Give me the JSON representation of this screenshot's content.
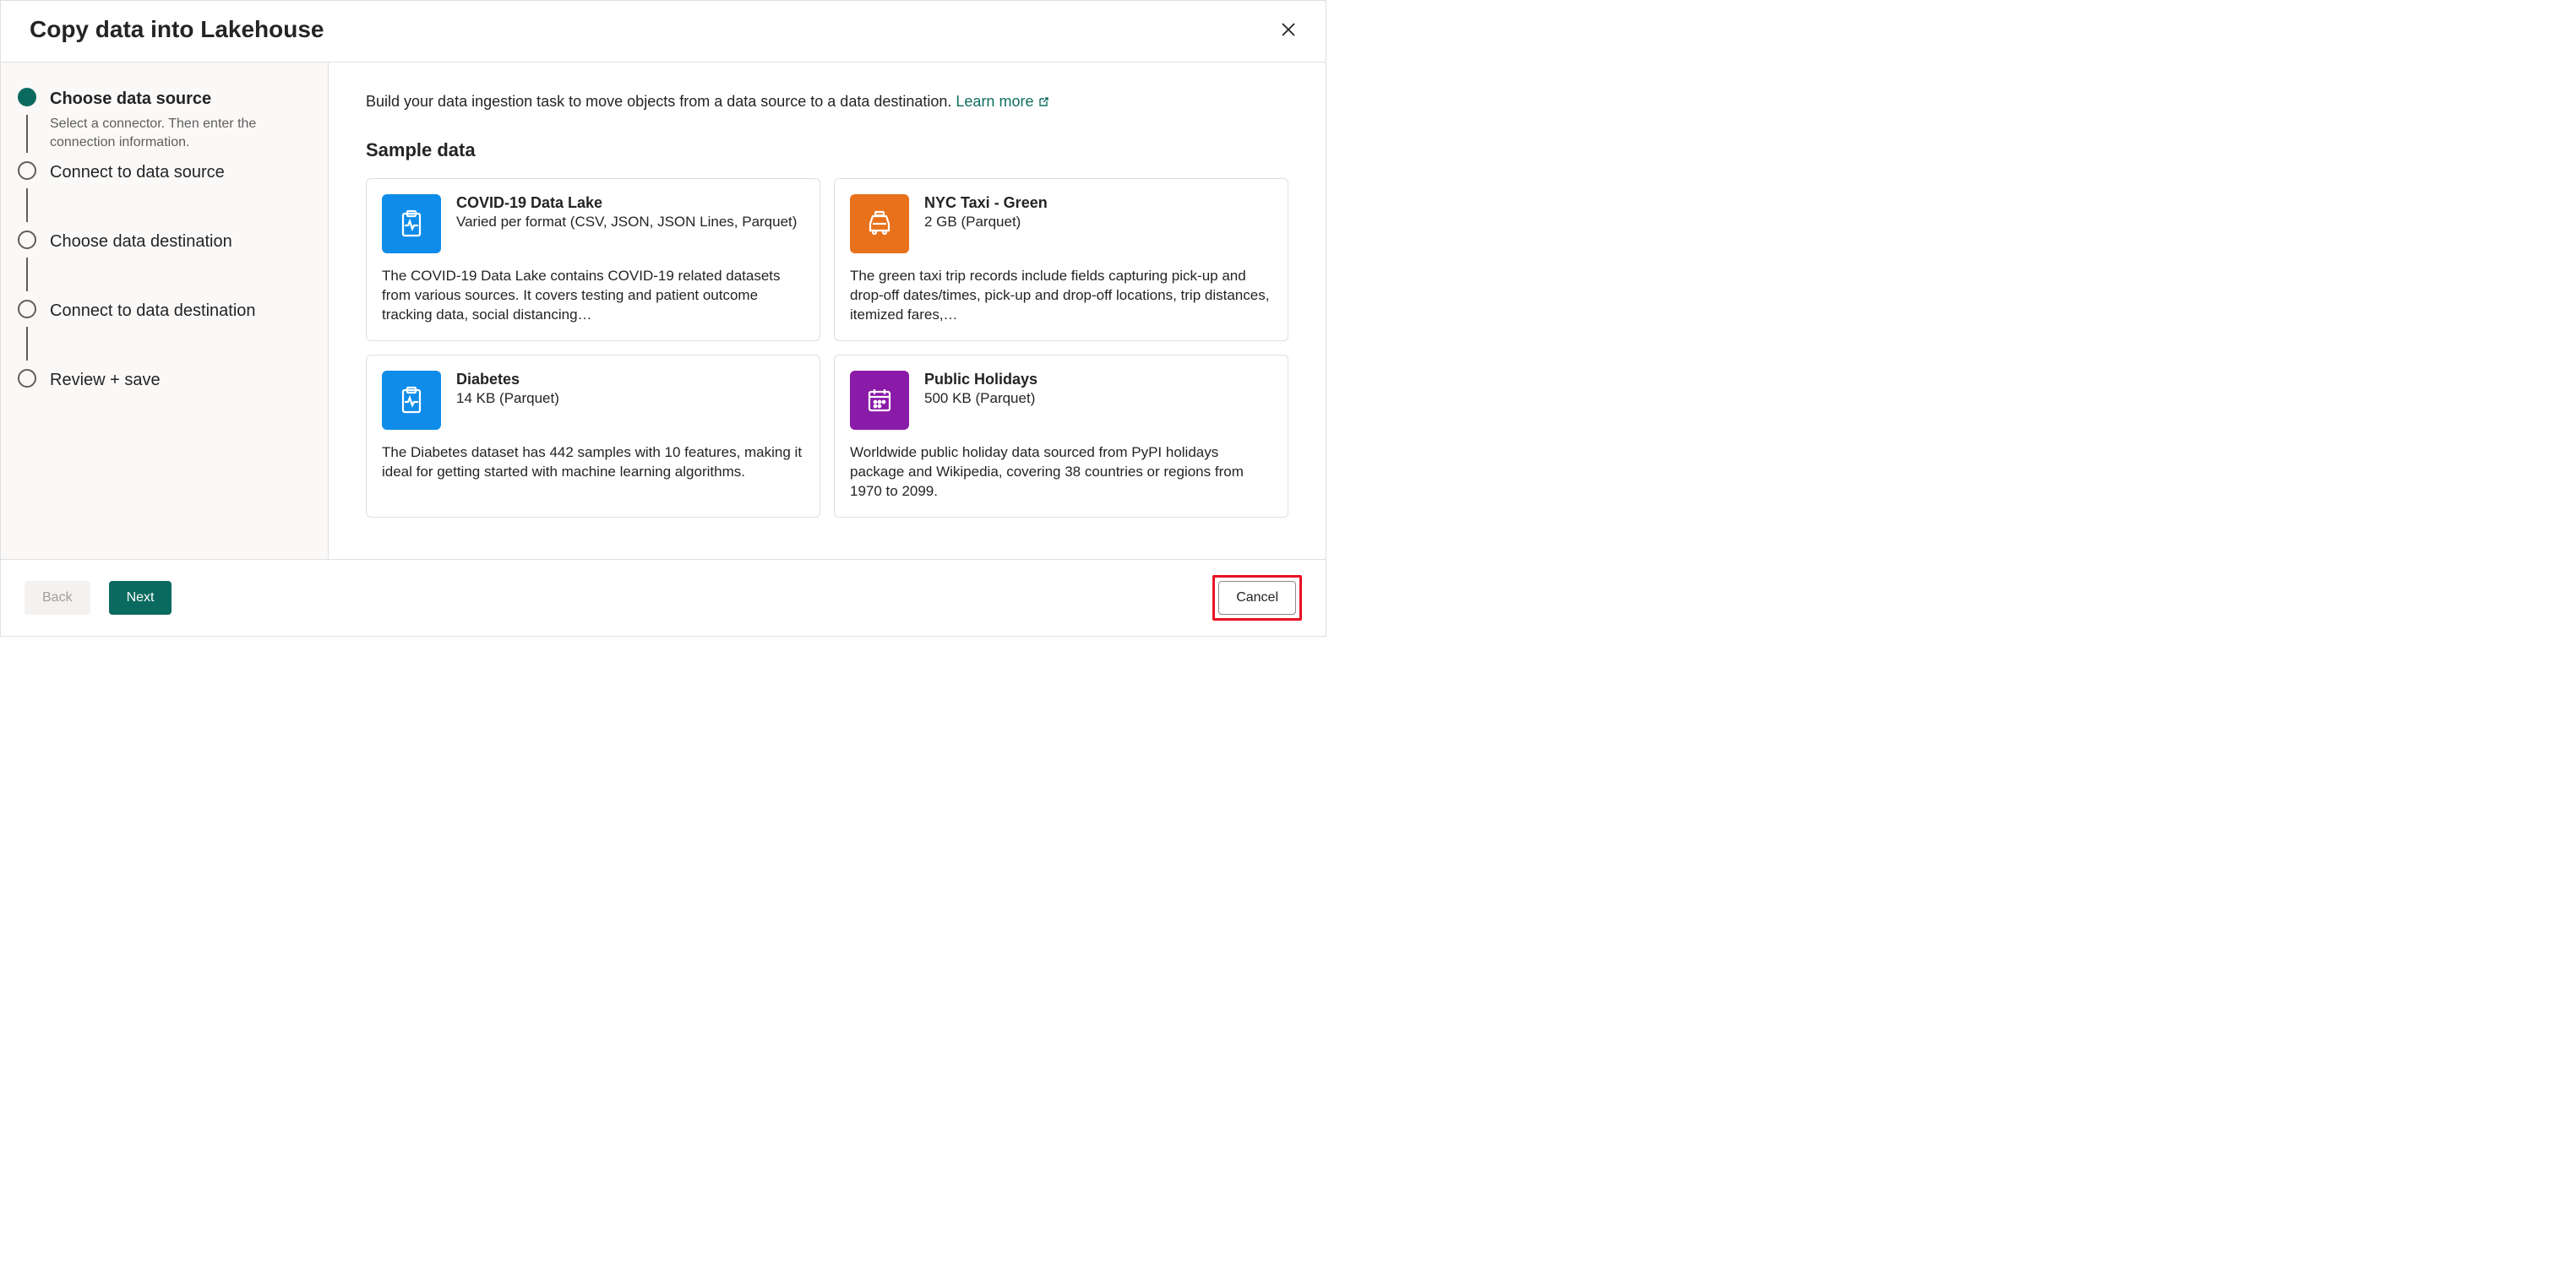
{
  "header": {
    "title": "Copy data into Lakehouse"
  },
  "sidebar": {
    "steps": [
      {
        "title": "Choose data source",
        "desc": "Select a connector. Then enter the connection information.",
        "active": true
      },
      {
        "title": "Connect to data source",
        "desc": "",
        "active": false
      },
      {
        "title": "Choose data destination",
        "desc": "",
        "active": false
      },
      {
        "title": "Connect to data destination",
        "desc": "",
        "active": false
      },
      {
        "title": "Review + save",
        "desc": "",
        "active": false
      }
    ]
  },
  "main": {
    "intro_text": "Build your data ingestion task to move objects from a data source to a data destination. ",
    "learn_more_label": "Learn more",
    "section_title": "Sample data",
    "cards": [
      {
        "title": "COVID-19 Data Lake",
        "sub": "Varied per format (CSV, JSON, JSON Lines, Parquet)",
        "desc": "The COVID-19 Data Lake contains COVID-19 related datasets from various sources. It covers testing and patient outcome tracking data, social distancing…",
        "icon": "clipboard-pulse-icon",
        "color": "#0f8ce9"
      },
      {
        "title": "NYC Taxi - Green",
        "sub": "2 GB (Parquet)",
        "desc": "The green taxi trip records include fields capturing pick-up and drop-off dates/times, pick-up and drop-off locations, trip distances, itemized fares,…",
        "icon": "taxi-icon",
        "color": "#e8711c"
      },
      {
        "title": "Diabetes",
        "sub": "14 KB (Parquet)",
        "desc": "The Diabetes dataset has 442 samples with 10 features, making it ideal for getting started with machine learning algorithms.",
        "icon": "clipboard-pulse-icon",
        "color": "#0f8ce9"
      },
      {
        "title": "Public Holidays",
        "sub": "500 KB (Parquet)",
        "desc": "Worldwide public holiday data sourced from PyPI holidays package and Wikipedia, covering 38 countries or regions from 1970 to 2099.",
        "icon": "calendar-icon",
        "color": "#8a1aa8"
      }
    ]
  },
  "footer": {
    "back_label": "Back",
    "next_label": "Next",
    "cancel_label": "Cancel"
  }
}
